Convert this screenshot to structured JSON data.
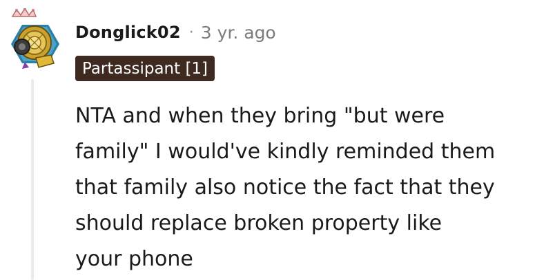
{
  "comment": {
    "author": "Donglick02",
    "separator": "·",
    "timestamp": "3 yr. ago",
    "flair": "Partassipant [1]",
    "body_lines": [
      "NTA and when they bring \"but were",
      "family\" I would've kindly reminded them",
      "that family also notice the fact that they",
      "should replace broken property like",
      "your phone"
    ],
    "avatar": "crowned-gold-medallion-avatar"
  },
  "colors": {
    "flair_background": "#3f2a22",
    "flair_text": "#ffffff",
    "timestamp": "#7c7c7c",
    "thread_line": "#e9eaec",
    "text": "#1a1a1b"
  }
}
